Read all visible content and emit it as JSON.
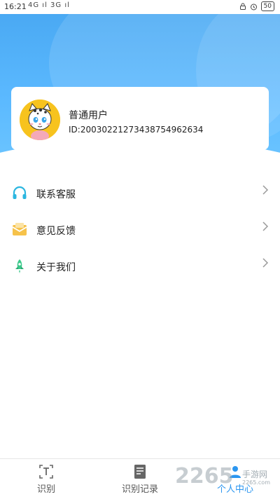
{
  "status_bar": {
    "time": "16:21",
    "signal": "4G ıl 3G ıl",
    "battery": "50"
  },
  "profile": {
    "name": "普通用户",
    "id_text": "ID:20030221273438754962634"
  },
  "menu": {
    "items": [
      {
        "label": "联系客服",
        "icon": "headset-icon"
      },
      {
        "label": "意见反馈",
        "icon": "envelope-icon"
      },
      {
        "label": "关于我们",
        "icon": "rocket-icon"
      }
    ]
  },
  "tabs": [
    {
      "label": "识别",
      "icon": "text-scan-icon"
    },
    {
      "label": "识别记录",
      "icon": "document-icon"
    },
    {
      "label": "个人中心",
      "icon": "person-icon",
      "active": true
    }
  ],
  "watermark": {
    "number": "2265",
    "text": "手游网",
    "url": "2265.com"
  },
  "colors": {
    "header_blue": "#5bb9ff",
    "accent": "#2b96f0",
    "avatar_bg": "#f7c31e"
  }
}
